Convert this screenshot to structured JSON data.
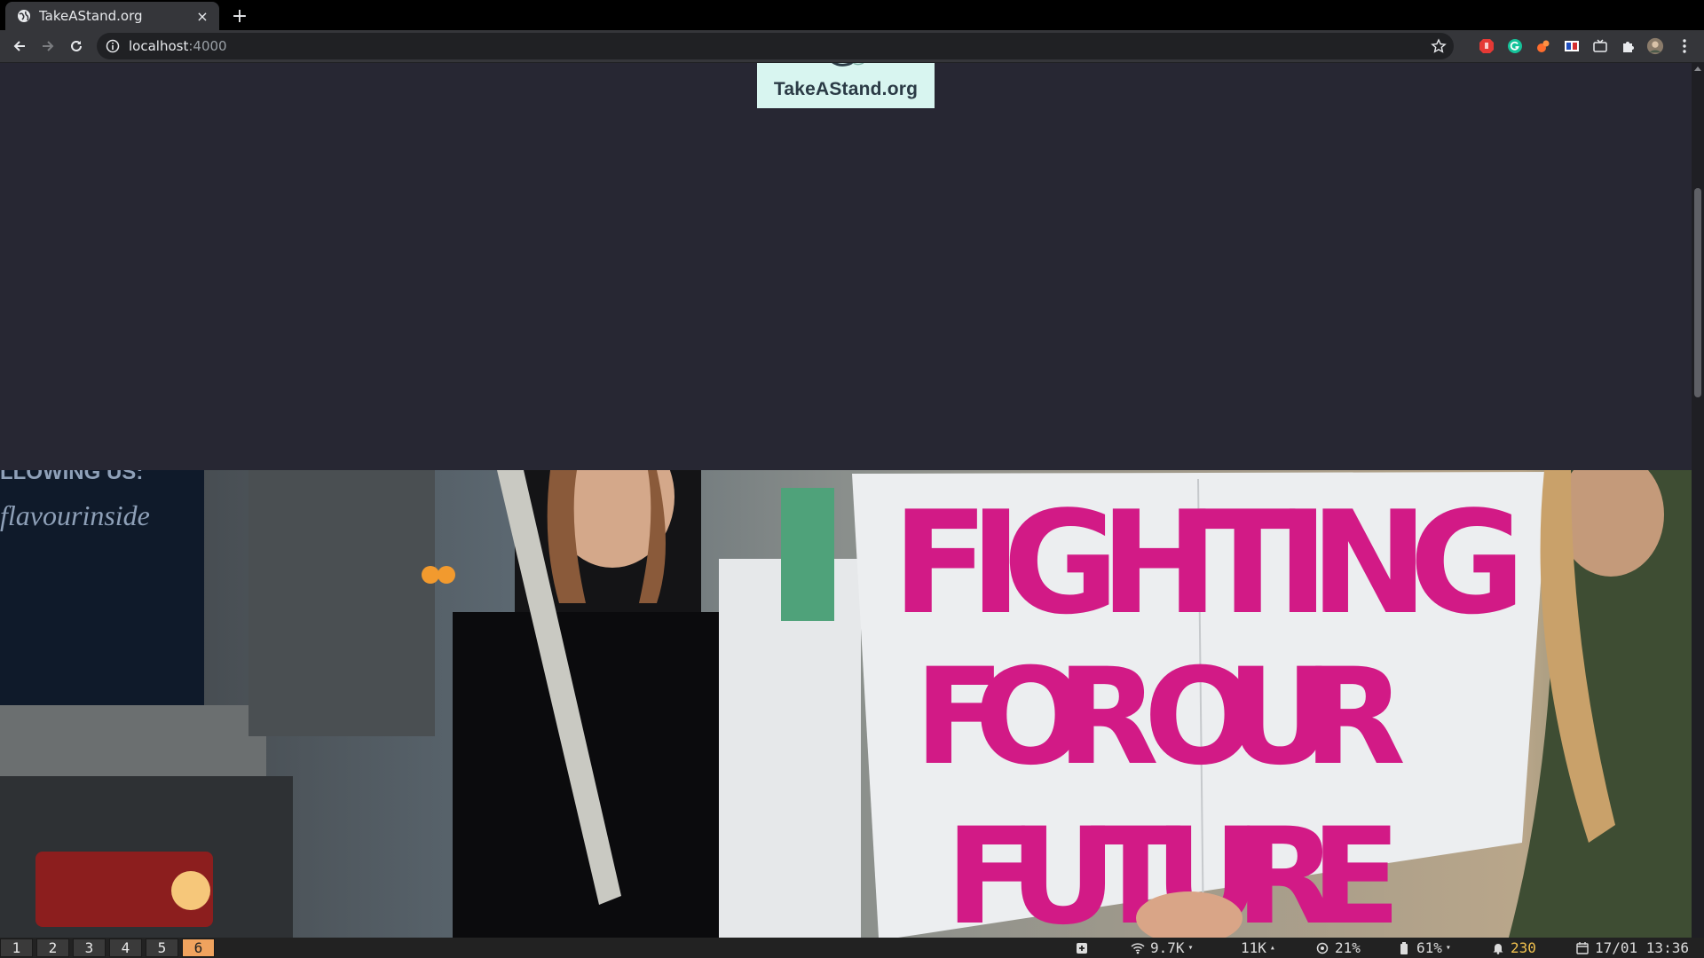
{
  "browser": {
    "tab": {
      "title": "TakeAStand.org",
      "favicon": "globe-icon",
      "close": "×"
    },
    "new_tab": "+",
    "url": {
      "host": "localhost",
      "port": ":4000"
    }
  },
  "page": {
    "logo_text": "TakeAStand.org",
    "hero": {
      "sign_lines": [
        "FIGHTING",
        "FOR OUR",
        "FUTURE"
      ],
      "truck_text_1": "LLOWING US:",
      "truck_text_2": "flavourinside"
    }
  },
  "statusbar": {
    "workspaces": [
      "1",
      "2",
      "3",
      "4",
      "5",
      "6"
    ],
    "active_workspace": "6",
    "download": "9.7K",
    "upload": "11K",
    "cpu": "21%",
    "battery": "61%",
    "notifications": "230",
    "datetime": "17/01 13:36"
  },
  "colors": {
    "tab_bg": "#35363a",
    "page_bg": "#272733",
    "logo_bg": "#d8f5f0",
    "active_ws": "#f0a35e",
    "sign_ink": "#d21a86"
  }
}
